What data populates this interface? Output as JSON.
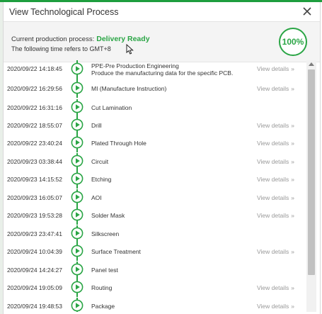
{
  "modal": {
    "title": "View Technological Process"
  },
  "summary": {
    "current_label": "Current production process:",
    "current_status": "Delivery Ready",
    "timezone_note": "The following time refers to GMT+8",
    "progress_text": "100%",
    "progress_value": 1.0
  },
  "colors": {
    "accent_green": "#2aa545",
    "muted_link": "#999999"
  },
  "icons": {
    "close": "close-icon",
    "step": "play-circle-icon",
    "details": "double-chevron-right-icon"
  },
  "steps": [
    {
      "time": "2020/09/22 14:18:45",
      "name": "PPE-Pre Production Engineering",
      "description": "Produce the manufacturing data for the specific PCB.",
      "details": "View details"
    },
    {
      "time": "2020/09/22 16:29:56",
      "name": "MI (Manufacture Instruction)",
      "details": "View details"
    },
    {
      "time": "2020/09/22 16:31:16",
      "name": "Cut Lamination"
    },
    {
      "time": "2020/09/22 18:55:07",
      "name": "Drill",
      "details": "View details"
    },
    {
      "time": "2020/09/22 23:40:24",
      "name": "Plated Through Hole",
      "details": "View details"
    },
    {
      "time": "2020/09/23 03:38:44",
      "name": "Circuit",
      "details": "View details"
    },
    {
      "time": "2020/09/23 14:15:52",
      "name": "Etching",
      "details": "View details"
    },
    {
      "time": "2020/09/23 16:05:07",
      "name": "AOI",
      "details": "View details"
    },
    {
      "time": "2020/09/23 19:53:28",
      "name": "Solder Mask",
      "details": "View details"
    },
    {
      "time": "2020/09/23 23:47:41",
      "name": "Silkscreen"
    },
    {
      "time": "2020/09/24 10:04:39",
      "name": "Surface Treatment",
      "details": "View details"
    },
    {
      "time": "2020/09/24 14:24:27",
      "name": "Panel test"
    },
    {
      "time": "2020/09/24 19:05:09",
      "name": "Routing",
      "details": "View details"
    },
    {
      "time": "2020/09/24 19:48:53",
      "name": "Package",
      "details": "View details"
    }
  ]
}
